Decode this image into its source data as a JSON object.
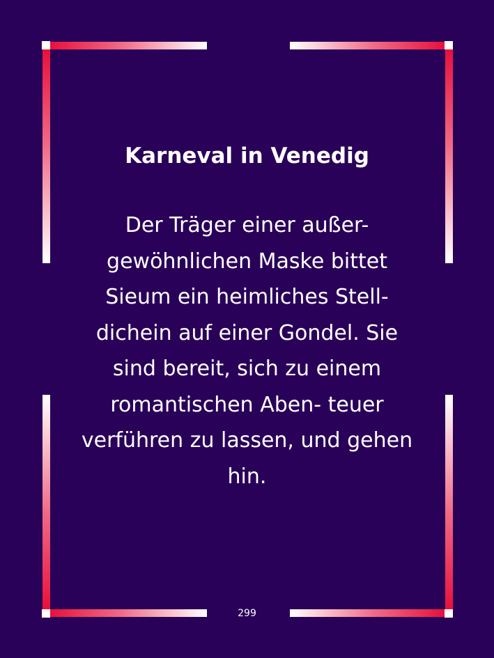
{
  "page": {
    "title": "Karneval in Venedig",
    "body_lines": "Der Träger einer außer-\ngewöhnlichen Maske bittet\nSieum ein heimliches Stell-\ndichein auf einer Gondel. Sie\nsind bereit, sich zu einem\nromantischen Aben- teuer\nverführen zu lassen, und gehen\nhin.",
    "page_number": "299"
  },
  "colors": {
    "background": "#2a0158",
    "frame_red": "#e8103c",
    "frame_white": "#ffffff",
    "text": "#ffffff"
  }
}
